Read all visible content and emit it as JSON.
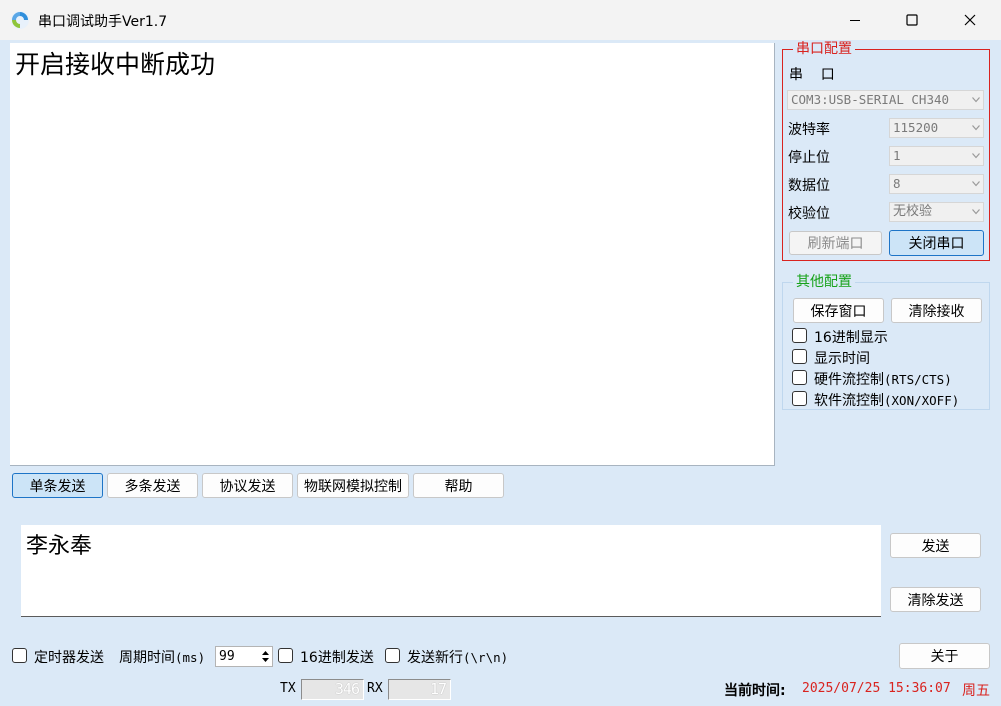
{
  "window": {
    "title": "串口调试助手Ver1.7",
    "icon": "app-swirl-icon",
    "controls": [
      "minimize-icon",
      "maximize-icon",
      "close-icon"
    ]
  },
  "receive": {
    "text": "开启接收中断成功"
  },
  "serial_config": {
    "legend": "串口配置",
    "port_label": "串    口",
    "port_value": "COM3:USB-SERIAL CH340",
    "baud_label": "波特率",
    "baud_value": "115200",
    "stop_label": "停止位",
    "stop_value": "1",
    "data_label": "数据位",
    "data_value": "8",
    "parity_label": "校验位",
    "parity_value": "无校验",
    "refresh_button": "刷新端口",
    "close_button": "关闭串口"
  },
  "other_config": {
    "legend": "其他配置",
    "save_button": "保存窗口",
    "clear_recv_button": "清除接收",
    "hex_display": "16进制显示",
    "show_time": "显示时间",
    "hw_flow_prefix": "硬件流控制",
    "hw_flow_suffix": "(RTS/CTS)",
    "sw_flow_prefix": "软件流控制",
    "sw_flow_suffix": "(XON/XOFF)"
  },
  "tabs": [
    "单条发送",
    "多条发送",
    "协议发送",
    "物联网模拟控制",
    "帮助"
  ],
  "send": {
    "text": "李永奉",
    "send_button": "发送",
    "clear_button": "清除发送"
  },
  "options": {
    "timer_send": "定时器发送",
    "period_prefix": "周期时间",
    "period_unit": "(ms)",
    "period_value": "99",
    "hex_send": "16进制发送",
    "newline_prefix": "发送新行",
    "newline_suffix": "(\\r\\n)",
    "about_button": "关于"
  },
  "status": {
    "tx_label": "TX",
    "tx_value": "346",
    "rx_label": "RX",
    "rx_value": "17",
    "time_label": "当前时间:",
    "time_value": "2025/07/25 15:36:07",
    "weekday": "周五"
  },
  "colors": {
    "panel_bg": "#dbe9f7",
    "serial_accent": "#d9231f",
    "other_accent": "#17a21a",
    "active_blue": "#1d74c7"
  }
}
